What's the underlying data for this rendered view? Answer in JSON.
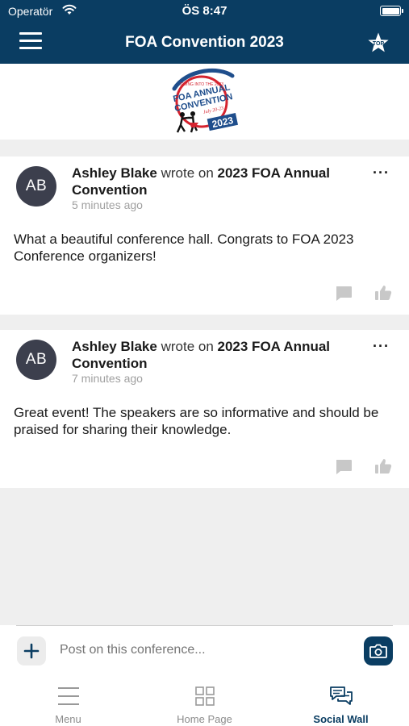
{
  "status_bar": {
    "carrier": "Operatör",
    "time": "ÖS 8:47"
  },
  "header": {
    "title": "FOA Convention 2023"
  },
  "logo": {
    "text": "FOA ANNUAL CONVENTION 2023"
  },
  "posts": [
    {
      "initials": "AB",
      "author": "Ashley Blake",
      "verb": "wrote on",
      "target": "2023 FOA Annual Convention",
      "time": "5 minutes ago",
      "body": "What a beautiful conference hall. Congrats to FOA 2023 Conference organizers!"
    },
    {
      "initials": "AB",
      "author": "Ashley Blake",
      "verb": "wrote on",
      "target": "2023 FOA Annual Convention",
      "time": "7 minutes ago",
      "body": "Great event! The speakers are so informative and should be praised for sharing their knowledge."
    }
  ],
  "composer": {
    "placeholder": "Post on this conference..."
  },
  "tabs": [
    {
      "label": "Menu",
      "icon": "menu-icon"
    },
    {
      "label": "Home Page",
      "icon": "grid-icon"
    },
    {
      "label": "Social Wall",
      "icon": "chat-bubbles-icon"
    }
  ],
  "colors": {
    "primary": "#0a3d62",
    "avatar": "#3c3f4d",
    "logo_red": "#d5232f",
    "logo_blue": "#1f4e8c"
  }
}
